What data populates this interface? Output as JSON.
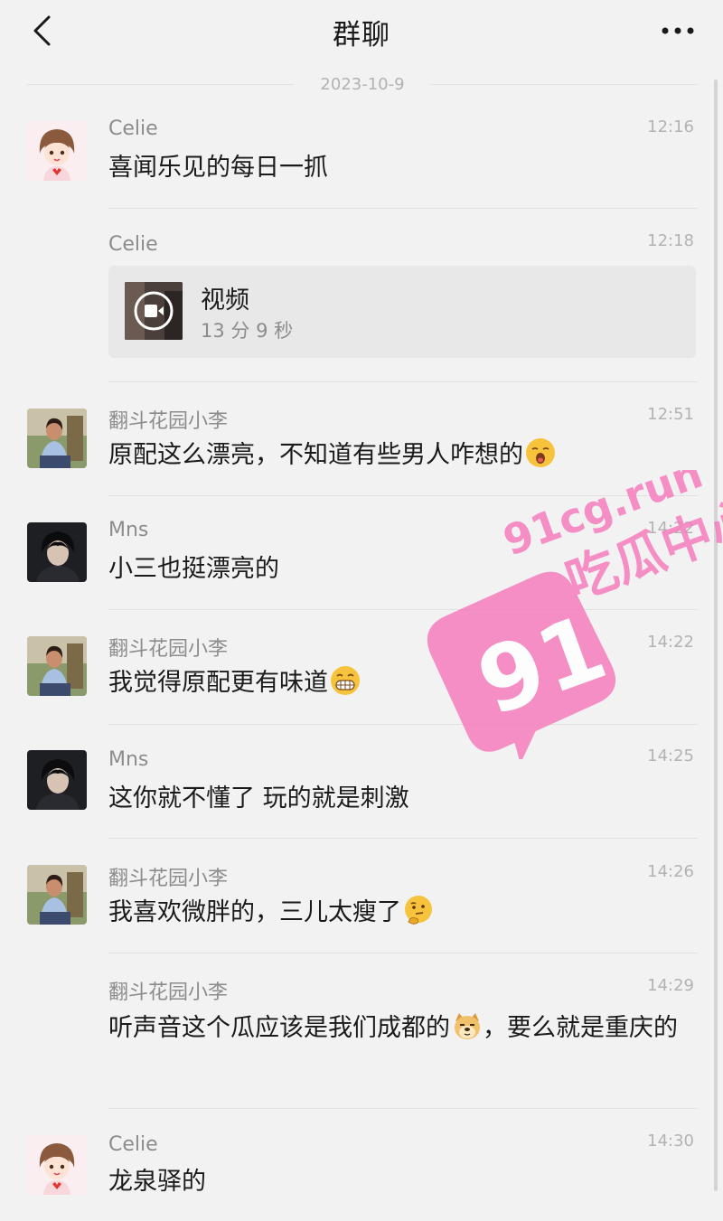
{
  "header": {
    "title": "群聊"
  },
  "date_divider": "2023-10-9",
  "messages": [
    {
      "name": "Celie",
      "time": "12:16",
      "text": "喜闻乐见的每日一抓"
    },
    {
      "name": "Celie",
      "time": "12:18",
      "video": {
        "title": "视频",
        "duration": "13 分 9 秒"
      }
    },
    {
      "name": "翻斗花园小李",
      "time": "12:51",
      "text": "原配这么漂亮，不知道有些男人咋想的",
      "emoji": "yawning-face-icon"
    },
    {
      "name": "Mns",
      "time": "14:22",
      "text": "小三也挺漂亮的"
    },
    {
      "name": "翻斗花园小李",
      "time": "14:22",
      "text": "我觉得原配更有味道",
      "emoji": "grinning-face-icon"
    },
    {
      "name": "Mns",
      "time": "14:25",
      "text": "这你就不懂了 玩的就是刺激"
    },
    {
      "name": "翻斗花园小李",
      "time": "14:26",
      "text": "我喜欢微胖的，三儿太瘦了",
      "emoji": "thinking-face-icon"
    },
    {
      "name": "翻斗花园小李",
      "time": "14:29",
      "text_a": "听声音这个瓜应该是我们成都的",
      "text_b": "，要么就是重庆的",
      "emoji": "doge-icon"
    },
    {
      "name": "Celie",
      "time": "14:30",
      "text": "龙泉驿的"
    }
  ],
  "watermark": {
    "url": "91cg.run",
    "brand": "吃瓜中心",
    "logo": "91"
  },
  "colors": {
    "background": "#f2f2f2",
    "watermark": "#f57dbc"
  }
}
